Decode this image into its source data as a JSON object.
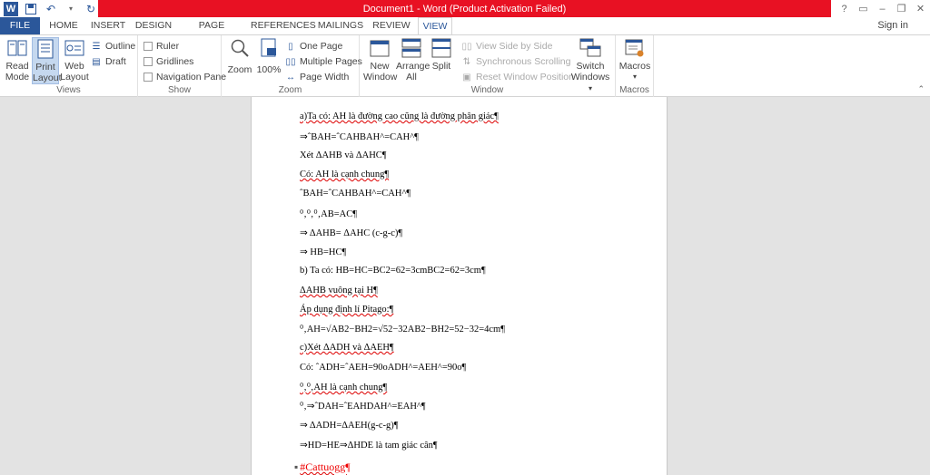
{
  "window": {
    "title": "Document1 - Word (Product Activation Failed)",
    "controls": [
      "?",
      "▭",
      "–",
      "❐",
      "✕"
    ]
  },
  "qat": {
    "logo": "W",
    "save_icon": "save-icon",
    "undo_icon": "undo-icon",
    "redo_icon": "redo-icon"
  },
  "tabs": [
    "FILE",
    "HOME",
    "INSERT",
    "DESIGN",
    "PAGE LAYOUT",
    "REFERENCES",
    "MAILINGS",
    "REVIEW",
    "VIEW"
  ],
  "active_tab": "VIEW",
  "signin": "Sign in",
  "ribbon": {
    "views": {
      "label": "Views",
      "read_mode": "Read Mode",
      "print_layout": "Print Layout",
      "web_layout": "Web Layout",
      "outline": "Outline",
      "draft": "Draft"
    },
    "show": {
      "label": "Show",
      "ruler": "Ruler",
      "gridlines": "Gridlines",
      "navigation_pane": "Navigation Pane"
    },
    "zoom": {
      "label": "Zoom",
      "zoom": "Zoom",
      "hundred": "100%",
      "one_page": "One Page",
      "multiple_pages": "Multiple Pages",
      "page_width": "Page Width"
    },
    "window": {
      "label": "Window",
      "new_window": "New Window",
      "arrange_all": "Arrange All",
      "split": "Split",
      "side_by_side": "View Side by Side",
      "sync_scrolling": "Synchronous Scrolling",
      "reset_position": "Reset Window Position",
      "switch_windows": "Switch Windows"
    },
    "macros": {
      "label": "Macros",
      "macros": "Macros"
    }
  },
  "document": {
    "lines": [
      "a)Ta có: AH là đường cao cũng là đường phân giác¶",
      "⇒ˆBAH=ˆCAHBAH^=CAH^¶",
      "Xét ΔAHB và ΔAHC¶",
      "Có: AH là cạnh chung¶",
      "ˆBAH=ˆCAHBAH^=CAH^¶",
      "⁰‚⁰‚⁰‚AB=AC¶",
      "⇒ ΔAHB= ΔAHC (c-g-c)¶",
      "⇒ HB=HC¶",
      "b) Ta có: HB=HC=BC2=62=3cmBC2=62=3cm¶",
      "ΔAHB vuông tại H¶",
      "Áp dụng định lí Pitago:¶",
      "⁰‚AH=√AB2−BH2=√52−32AB2−BH2=52−32=4cm¶",
      "c)Xét ΔADH và ΔAEH¶",
      "Có: ˆADH=ˆAEH=90oADH^=AEH^=90o¶",
      "⁰‚⁰‚AH là cạnh chung¶",
      "⁰‚⇒ˆDAH=ˆEAHDAH^=EAH^¶",
      "⇒ ΔADH=ΔAEH(g-c-g)¶",
      "⇒HD=HE⇒ΔHDE là tam giác cân¶"
    ],
    "hashtag": "#Cattuogg¶"
  }
}
